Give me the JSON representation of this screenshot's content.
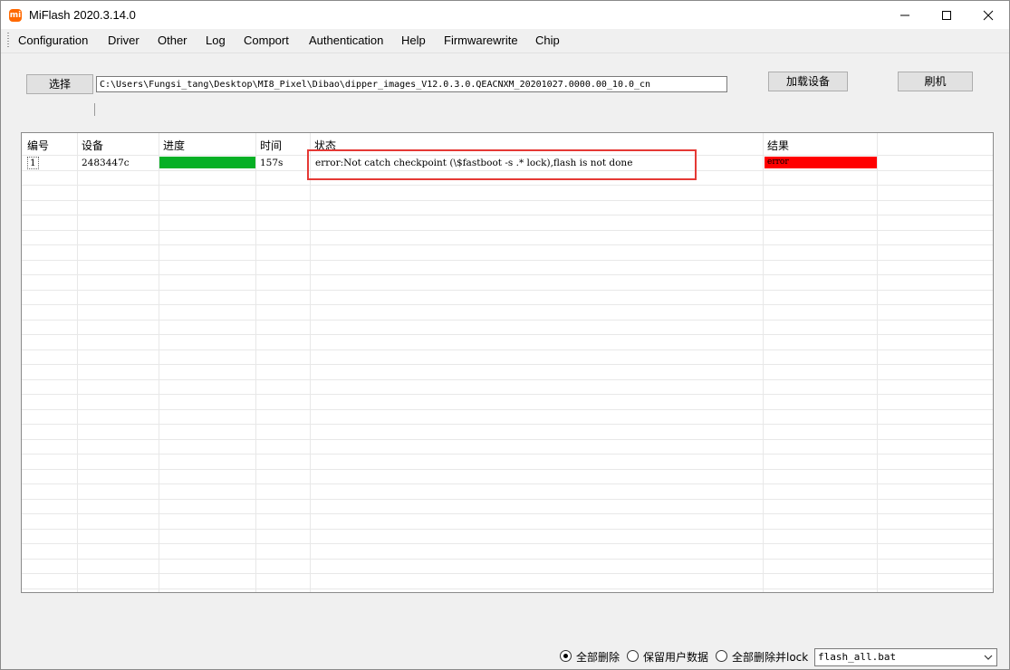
{
  "window": {
    "title": "MiFlash 2020.3.14.0",
    "icon_text": "mi"
  },
  "menu": [
    "Configuration",
    "Driver",
    "Other",
    "Log",
    "Comport",
    "Authentication",
    "Help",
    "Firmwarewrite",
    "Chip"
  ],
  "toolbar": {
    "select_label": "选择",
    "path": "C:\\Users\\Fungsi_tang\\Desktop\\MI8_Pixel\\Dibao\\dipper_images_V12.0.3.0.QEACNXM_20201027.0000.00_10.0_cn",
    "load_devices_label": "加载设备",
    "flash_label": "刷机"
  },
  "table": {
    "headers": [
      "编号",
      "设备",
      "进度",
      "时间",
      "状态",
      "结果"
    ],
    "rows": [
      {
        "id": "1",
        "device": "2483447c",
        "progress": 1.0,
        "time": "157s",
        "status": "error:Not catch checkpoint (\\$fastboot -s .* lock),flash is not done",
        "result": "error"
      }
    ]
  },
  "colors": {
    "progress": "#06b025",
    "error": "#ff0000",
    "highlight": "#e53935"
  },
  "bottom": {
    "options": [
      "全部删除",
      "保留用户数据",
      "全部删除并lock"
    ],
    "selected_option": "全部删除",
    "script": "flash_all.bat"
  }
}
